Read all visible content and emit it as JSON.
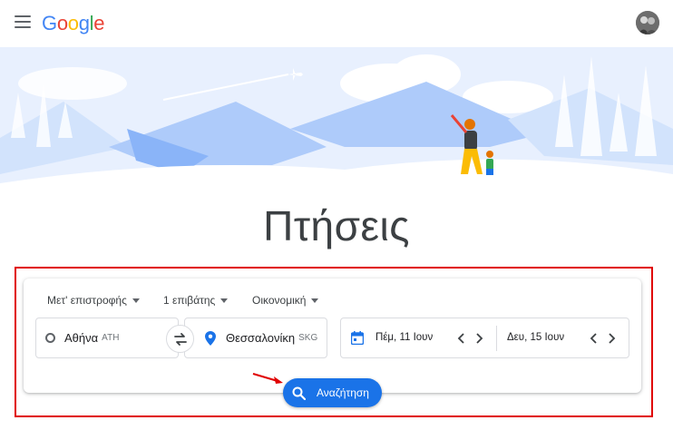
{
  "header": {
    "logo_letters": [
      {
        "ch": "G",
        "color": "#4285f4"
      },
      {
        "ch": "o",
        "color": "#ea4335"
      },
      {
        "ch": "o",
        "color": "#fbbc05"
      },
      {
        "ch": "g",
        "color": "#4285f4"
      },
      {
        "ch": "l",
        "color": "#34a853"
      },
      {
        "ch": "e",
        "color": "#ea4335"
      }
    ],
    "menu_icon": "hamburger-menu-icon",
    "avatar_icon": "user-avatar"
  },
  "page": {
    "title": "Πτήσεις"
  },
  "search": {
    "options": {
      "trip_type": "Μετ' επιστροφής",
      "passengers": "1 επιβάτης",
      "cabin_class": "Οικονομική"
    },
    "origin": {
      "city": "Αθήνα",
      "code": "ATH"
    },
    "destination": {
      "city": "Θεσσαλονίκη",
      "code": "SKG"
    },
    "departure_date": "Πέμ, 11 Ιουν",
    "return_date": "Δευ, 15 Ιουν",
    "search_button_label": "Αναζήτηση"
  },
  "colors": {
    "accent_blue": "#1a73e8",
    "annotation_red": "#e00000",
    "hero_sky": "#e8f0fe",
    "hero_mountain": "#aecbfa"
  }
}
